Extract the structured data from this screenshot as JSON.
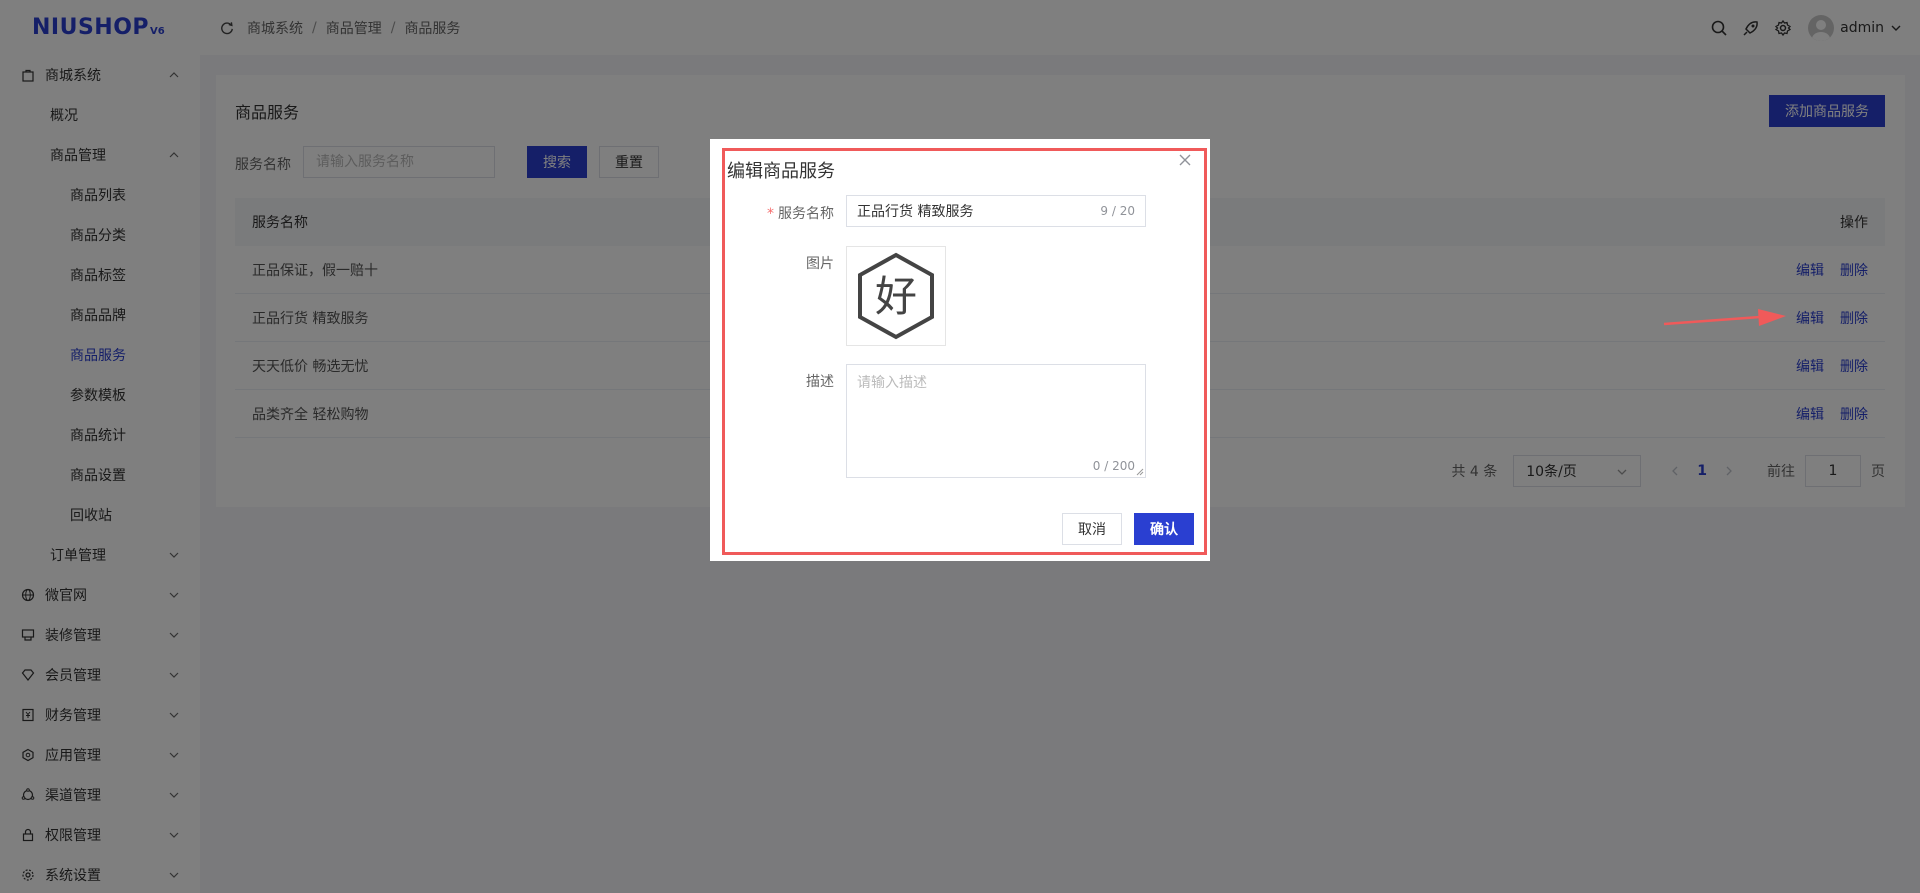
{
  "brand": {
    "logo_text": "NIUSHOP",
    "version": "V6",
    "color": "#2a3fd1"
  },
  "sidebar": {
    "items": [
      {
        "label": "商城系统",
        "level": 1,
        "icon": "shop-icon",
        "expanded": true
      },
      {
        "label": "概况",
        "level": 2
      },
      {
        "label": "商品管理",
        "level": 2,
        "expanded": true
      },
      {
        "label": "商品列表",
        "level": 3
      },
      {
        "label": "商品分类",
        "level": 3
      },
      {
        "label": "商品标签",
        "level": 3
      },
      {
        "label": "商品品牌",
        "level": 3
      },
      {
        "label": "商品服务",
        "level": 3,
        "active": true
      },
      {
        "label": "参数模板",
        "level": 3
      },
      {
        "label": "商品统计",
        "level": 3
      },
      {
        "label": "商品设置",
        "level": 3
      },
      {
        "label": "回收站",
        "level": 3
      },
      {
        "label": "订单管理",
        "level": 2,
        "expanded": false
      },
      {
        "label": "微官网",
        "level": 1,
        "icon": "globe-icon",
        "expanded": false
      },
      {
        "label": "装修管理",
        "level": 1,
        "icon": "decorate-icon",
        "expanded": false
      },
      {
        "label": "会员管理",
        "level": 1,
        "icon": "diamond-icon",
        "expanded": false
      },
      {
        "label": "财务管理",
        "level": 1,
        "icon": "finance-icon",
        "expanded": false
      },
      {
        "label": "应用管理",
        "level": 1,
        "icon": "app-icon",
        "expanded": false
      },
      {
        "label": "渠道管理",
        "level": 1,
        "icon": "channel-icon",
        "expanded": false
      },
      {
        "label": "权限管理",
        "level": 1,
        "icon": "lock-icon",
        "expanded": false
      },
      {
        "label": "系统设置",
        "level": 1,
        "icon": "gear-icon",
        "expanded": false
      }
    ]
  },
  "header": {
    "breadcrumb": [
      "商城系统",
      "商品管理",
      "商品服务"
    ],
    "username": "admin",
    "icons": [
      "search-icon",
      "rocket-icon",
      "gear-icon"
    ]
  },
  "main": {
    "title": "商品服务",
    "add_button": "添加商品服务",
    "search": {
      "label": "服务名称",
      "placeholder": "请输入服务名称",
      "search_button": "搜索",
      "reset_button": "重置"
    },
    "table": {
      "columns": [
        "服务名称",
        "操作"
      ],
      "rows": [
        {
          "name": "正品保证，假一赔十",
          "edit": "编辑",
          "delete": "删除"
        },
        {
          "name": "正品行货 精致服务",
          "edit": "编辑",
          "delete": "删除"
        },
        {
          "name": "天天低价 畅选无忧",
          "edit": "编辑",
          "delete": "删除"
        },
        {
          "name": "品类齐全 轻松购物",
          "edit": "编辑",
          "delete": "删除"
        }
      ]
    },
    "pagination": {
      "total_text": "共 4 条",
      "page_size": "10条/页",
      "current_page": "1",
      "goto_label": "前往",
      "goto_value": "1",
      "page_suffix": "页"
    }
  },
  "dialog": {
    "title": "编辑商品服务",
    "name_label": "服务名称",
    "name_value": "正品行货 精致服务",
    "name_count": "9 / 20",
    "image_label": "图片",
    "image_glyph": "好",
    "desc_label": "描述",
    "desc_placeholder": "请输入描述",
    "desc_count": "0 / 200",
    "cancel_button": "取消",
    "confirm_button": "确认"
  },
  "annotation": {
    "highlight_color": "#f05a5a"
  }
}
